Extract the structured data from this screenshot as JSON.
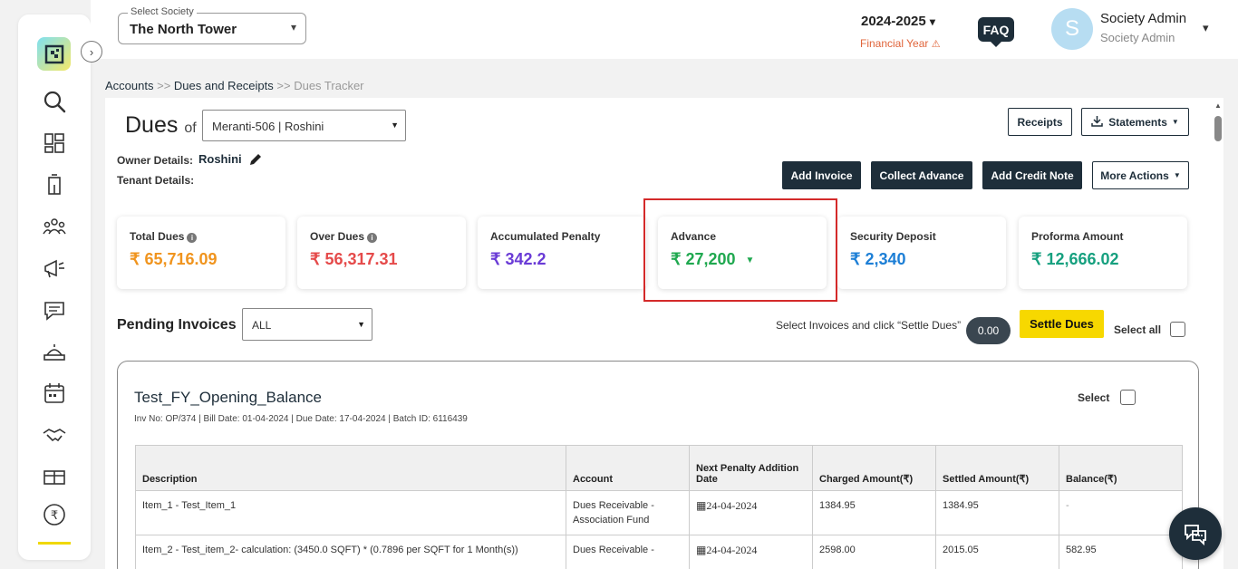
{
  "header": {
    "society_label": "Select Society",
    "society_value": "The North Tower",
    "fy_value": "2024-2025",
    "fy_caption": "Financial Year",
    "faq_label": "FAQ",
    "avatar_letter": "S",
    "user_name": "Society Admin",
    "user_role": "Society Admin"
  },
  "breadcrumb": {
    "items": [
      "Accounts",
      "Dues and Receipts",
      "Dues Tracker"
    ],
    "separator": ">>"
  },
  "dues": {
    "title": "Dues",
    "of": "of",
    "member": "Meranti-506 | Roshini",
    "owner_label": "Owner Details:",
    "owner_value": "Roshini",
    "tenant_label": "Tenant Details:"
  },
  "actions": {
    "receipts": "Receipts",
    "statements": "Statements",
    "add_invoice": "Add Invoice",
    "collect_advance": "Collect Advance",
    "add_credit_note": "Add Credit Note",
    "more_actions": "More Actions"
  },
  "cards": [
    {
      "label": "Total Dues",
      "value": "₹ 65,716.09",
      "color": "#f0941e",
      "info": true
    },
    {
      "label": "Over Dues",
      "value": "₹ 56,317.31",
      "color": "#e54a4a",
      "info": true
    },
    {
      "label": "Accumulated Penalty",
      "value": "₹ 342.2",
      "color": "#6a3bd6",
      "info": false
    },
    {
      "label": "Advance",
      "value": "₹ 27,200",
      "color": "#1fa84f",
      "info": false
    },
    {
      "label": "Security Deposit",
      "value": "₹ 2,340",
      "color": "#1d7fd6",
      "info": false
    },
    {
      "label": "Proforma Amount",
      "value": "₹ 12,666.02",
      "color": "#16a07f",
      "info": false
    }
  ],
  "pending": {
    "title": "Pending Invoices",
    "filter": "ALL",
    "hint": "Select Invoices and click “Settle Dues”",
    "selected_total": "0.00",
    "settle_label": "Settle Dues",
    "select_all_label": "Select all"
  },
  "invoice": {
    "title": "Test_FY_Opening_Balance",
    "meta": "Inv No: OP/374 | Bill Date: 01-04-2024 | Due Date: 17-04-2024 | Batch ID: 6116439",
    "select_label": "Select",
    "columns": [
      "Description",
      "Account",
      "Next Penalty Addition Date",
      "Charged Amount(₹)",
      "Settled Amount(₹)",
      "Balance(₹)"
    ],
    "rows": [
      {
        "description": "Item_1 - Test_Item_1",
        "account": "Dues Receivable - Association Fund",
        "date": "24-04-2024",
        "charged": "1384.95",
        "settled": "1384.95",
        "balance": "-"
      },
      {
        "description": "Item_2 - Test_item_2- calculation: (3450.0 SQFT) * (0.7896 per SQFT for 1 Month(s))",
        "account": "Dues Receivable -",
        "date": "24-04-2024",
        "charged": "2598.00",
        "settled": "2015.05",
        "balance": "582.95"
      }
    ]
  },
  "sidebar": {
    "icons": [
      "logo-icon",
      "search-icon",
      "dashboard-icon",
      "building-icon",
      "members-icon",
      "announcement-icon",
      "chat-icon",
      "helpdesk-icon",
      "calendar-icon",
      "handshake-icon",
      "facility-icon",
      "rupee-icon"
    ]
  }
}
